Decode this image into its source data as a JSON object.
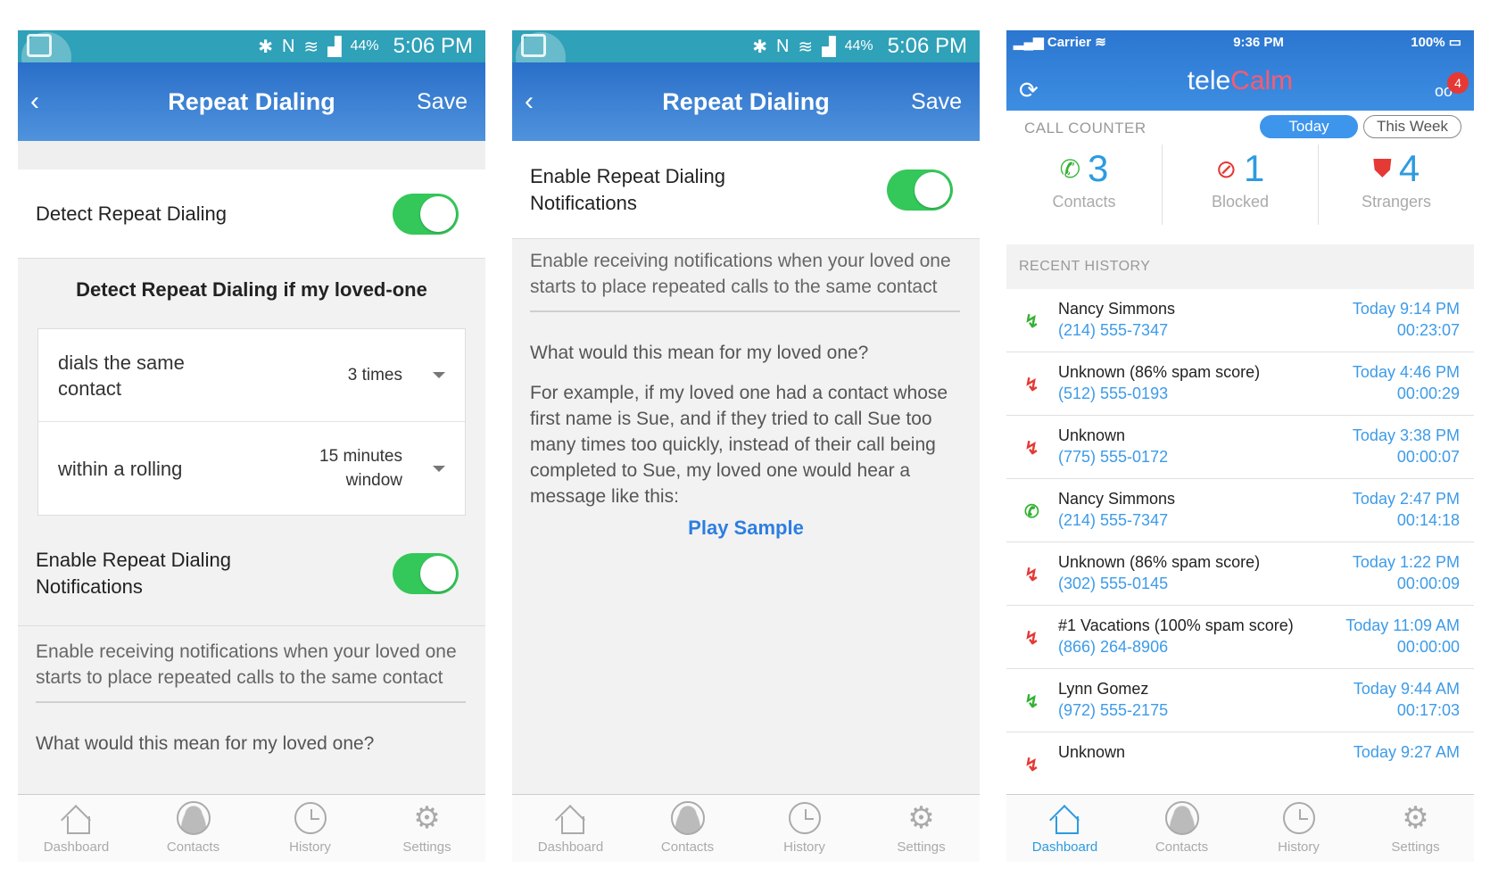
{
  "android": {
    "status_time": "5:06 PM",
    "battery": "44%",
    "title": "Repeat Dialing",
    "save": "Save"
  },
  "screen1": {
    "detect_label": "Detect Repeat Dialing",
    "sub_heading": "Detect Repeat Dialing if my loved-one",
    "option1_label": "dials the same contact",
    "option1_value": "3 times",
    "option2_label": "within a rolling",
    "option2_value": "15 minutes window",
    "enable_label": "Enable Repeat Dialing Notifications",
    "description": "Enable receiving notifications when your loved one starts to place repeated calls to the same contact",
    "question": "What would this mean for my loved one?"
  },
  "screen2": {
    "enable_label": "Enable Repeat Dialing Notifications",
    "description": "Enable receiving notifications when your loved one starts to place repeated calls to the same contact",
    "question": "What would this mean for my loved one?",
    "example": "For example, if my loved one had a contact whose first name is Sue, and if they tried to call Sue too many times too quickly, instead of their call being completed to Sue, my loved one would hear a message like this:",
    "play_sample": "Play Sample"
  },
  "nav": {
    "dashboard": "Dashboard",
    "contacts": "Contacts",
    "history": "History",
    "settings": "Settings"
  },
  "ios": {
    "carrier": "Carrier",
    "time": "9:36 PM",
    "battery": "100%",
    "brand_tele": "tele",
    "brand_calm": "Calm",
    "badge": "4",
    "call_counter": "CALL COUNTER",
    "seg_today": "Today",
    "seg_week": "This Week",
    "stats": [
      {
        "value": "3",
        "label": "Contacts"
      },
      {
        "value": "1",
        "label": "Blocked"
      },
      {
        "value": "4",
        "label": "Strangers"
      }
    ],
    "recent_history": "RECENT HISTORY",
    "history": [
      {
        "name": "Nancy Simmons",
        "phone": "(214) 555-7347",
        "time": "Today 9:14 PM",
        "duration": "00:23:07",
        "type": "in"
      },
      {
        "name": "Unknown (86% spam score)",
        "phone": "(512) 555-0193",
        "time": "Today 4:46 PM",
        "duration": "00:00:29",
        "type": "spam"
      },
      {
        "name": "Unknown",
        "phone": "(775) 555-0172",
        "time": "Today 3:38 PM",
        "duration": "00:00:07",
        "type": "spam"
      },
      {
        "name": "Nancy Simmons",
        "phone": "(214) 555-7347",
        "time": "Today 2:47 PM",
        "duration": "00:14:18",
        "type": "out"
      },
      {
        "name": "Unknown (86% spam score)",
        "phone": "(302) 555-0145",
        "time": "Today 1:22 PM",
        "duration": "00:00:09",
        "type": "spam"
      },
      {
        "name": "#1 Vacations (100% spam score)",
        "phone": "(866) 264-8906",
        "time": "Today 11:09 AM",
        "duration": "00:00:00",
        "type": "spam"
      },
      {
        "name": "Lynn Gomez",
        "phone": "(972) 555-2175",
        "time": "Today 9:44 AM",
        "duration": "00:17:03",
        "type": "in"
      },
      {
        "name": "Unknown",
        "phone": "",
        "time": "Today 9:27 AM",
        "duration": "",
        "type": "spam"
      }
    ]
  }
}
